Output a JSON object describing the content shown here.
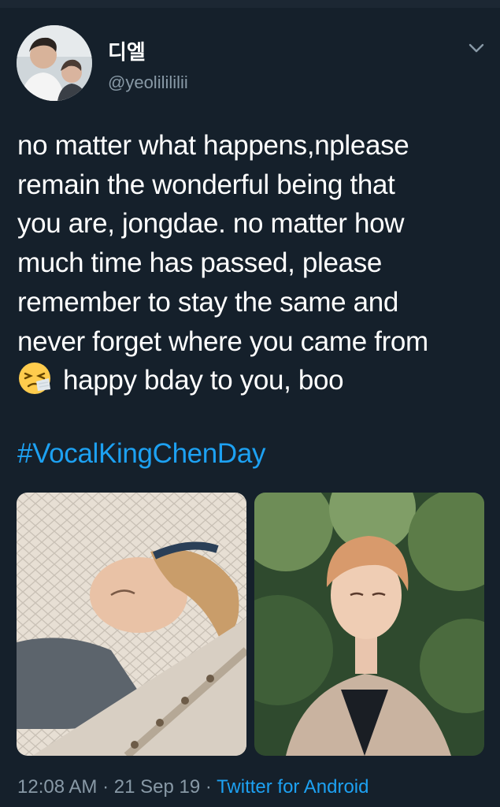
{
  "tweet": {
    "author": {
      "name": "디엘",
      "handle": "@yeolilililii"
    },
    "text_lines": [
      "no matter what happens,nplease",
      "remain the wonderful being that",
      "you are, jongdae. no matter how",
      "much time has passed, please",
      "remember to stay the same and",
      "never forget where you came from"
    ],
    "last_line": "happy bday to you, boo",
    "emoji": "sneezing-face",
    "hashtag": "#VocalKingChenDay",
    "timestamp": "12:08 AM · 21 Sep 19 · ",
    "source": "Twitter for Android",
    "colors": {
      "background": "#15202b",
      "text": "#ffffff",
      "secondary": "#8899a6",
      "link": "#1da1f2"
    }
  }
}
